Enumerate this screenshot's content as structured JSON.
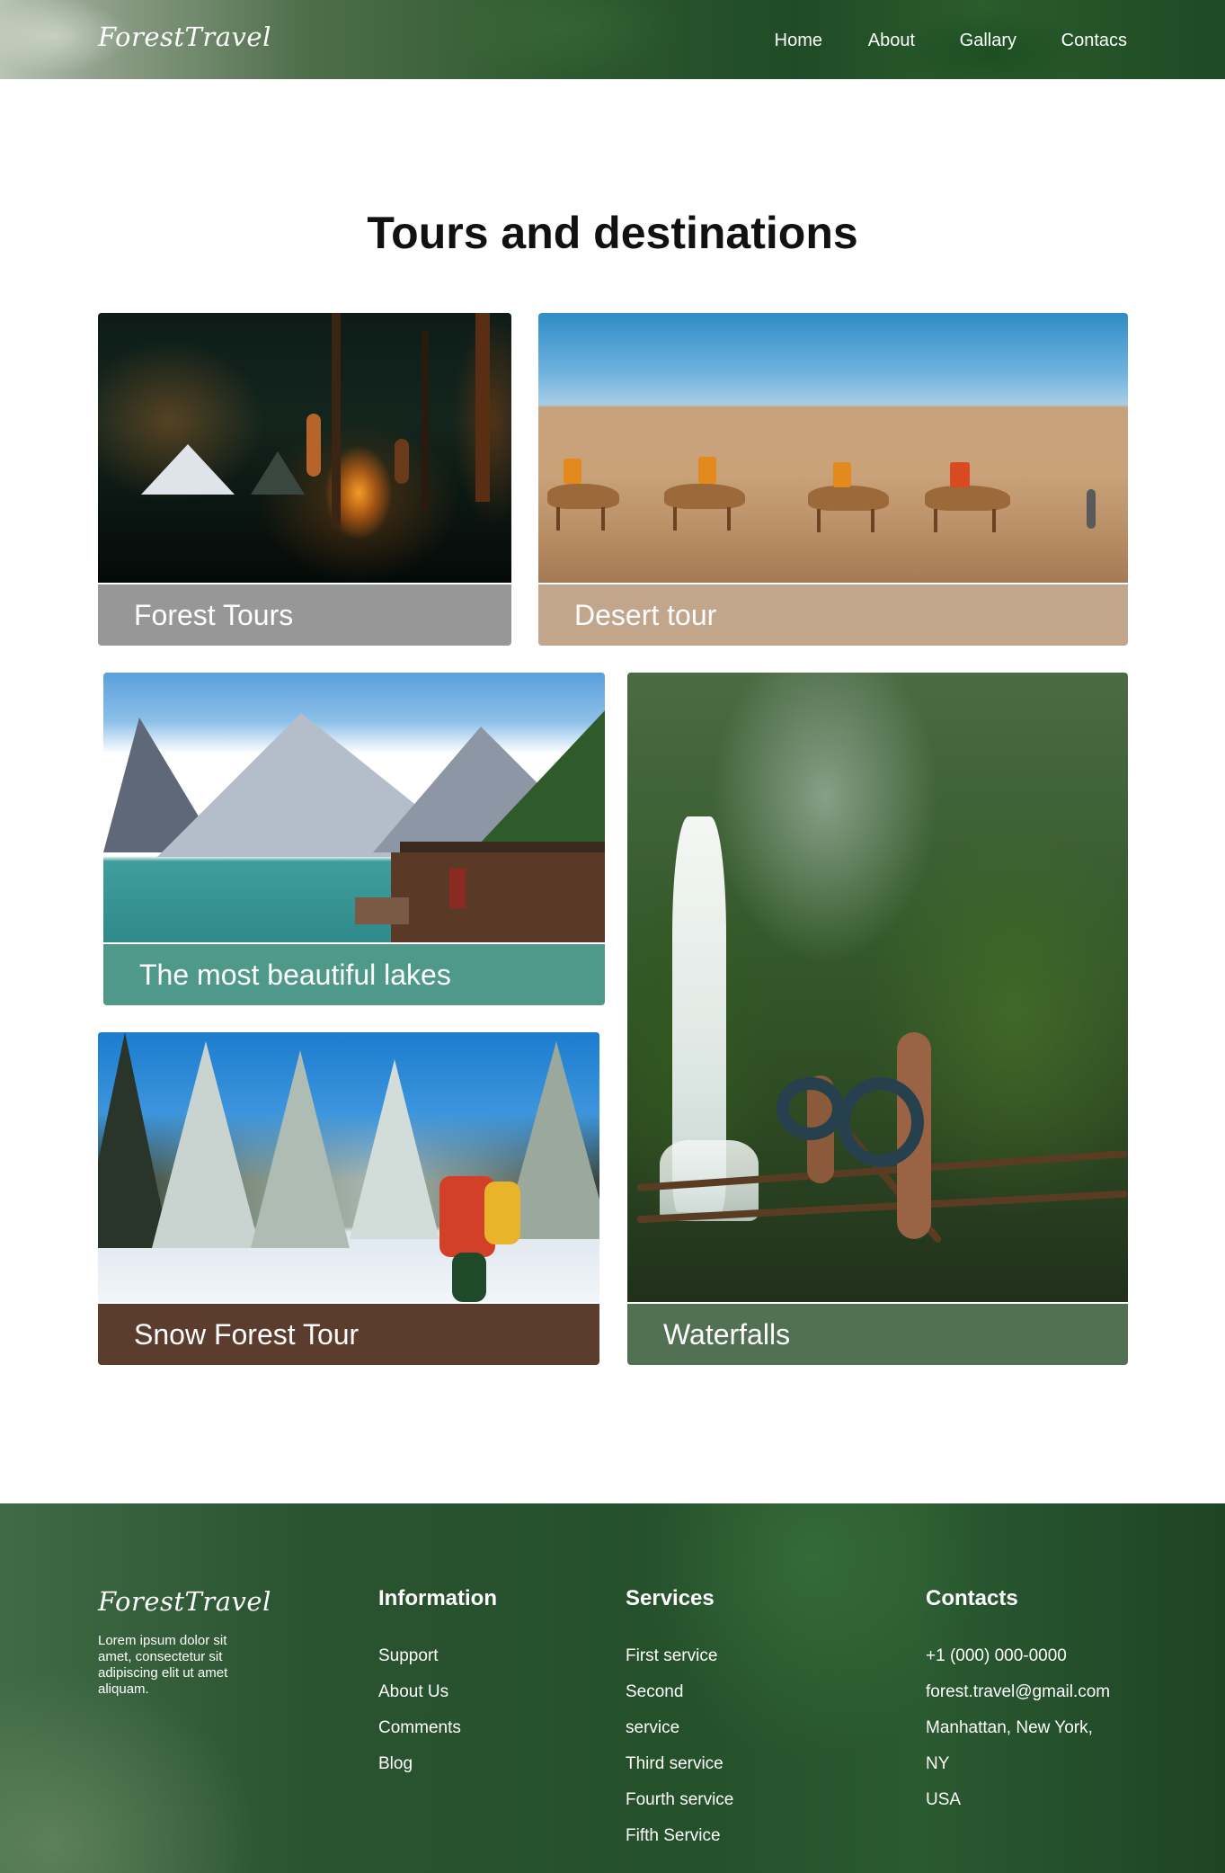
{
  "header": {
    "logo": "ForestTravel",
    "nav": [
      {
        "label": "Home"
      },
      {
        "label": "About"
      },
      {
        "label": "Gallary"
      },
      {
        "label": "Contacs"
      }
    ]
  },
  "main": {
    "title": "Tours and destinations",
    "cards": [
      {
        "label": "Forest Tours",
        "color": "#979797"
      },
      {
        "label": "Desert tour",
        "color": "#c2a68b"
      },
      {
        "label": "The most beautiful lakes",
        "color": "#4f998a"
      },
      {
        "label": "Waterfalls",
        "color": "#527052"
      },
      {
        "label": "Snow Forest Tour",
        "color": "#5b3c2d"
      }
    ]
  },
  "footer": {
    "logo": "ForestTravel",
    "description": "Lorem ipsum dolor sit amet, consectetur sit adipiscing elit ut amet aliquam.",
    "information": {
      "heading": "Information",
      "items": [
        "Support",
        "About Us",
        "Comments",
        "Blog"
      ]
    },
    "services": {
      "heading": "Services",
      "items": [
        "First service",
        "Second",
        "service",
        "Third service",
        "Fourth service",
        "Fifth Service"
      ]
    },
    "contacts": {
      "heading": "Contacts",
      "items": [
        "+1 (000) 000-0000",
        "forest.travel@gmail.com",
        "Manhattan, New York,",
        "NY",
        "USA"
      ]
    }
  }
}
